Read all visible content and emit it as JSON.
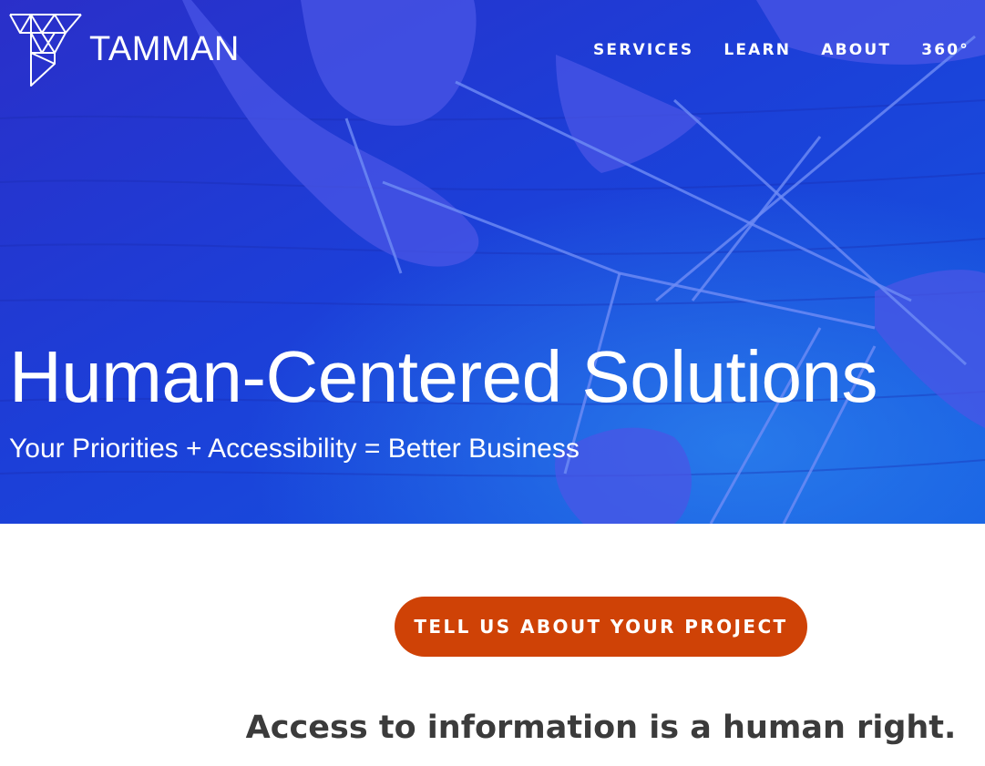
{
  "header": {
    "logo_text": "TAMMAN",
    "logo_icon": "geometric-triangle-logo-icon",
    "nav": [
      {
        "label": "SERVICES"
      },
      {
        "label": "LEARN"
      },
      {
        "label": "ABOUT"
      },
      {
        "label": "360°"
      }
    ]
  },
  "hero": {
    "title": "Human-Centered Solutions",
    "subtitle": "Your Priorities + Accessibility = Better Business",
    "background": "hands-with-strings-photo-blue-tint"
  },
  "cta": {
    "label": "TELL US ABOUT YOUR PROJECT"
  },
  "statement": {
    "text": "Access to information is a human right."
  },
  "colors": {
    "hero_blue": "#1e37d6",
    "cta_orange": "#cf4206",
    "text_dark": "#3b3b3b"
  }
}
